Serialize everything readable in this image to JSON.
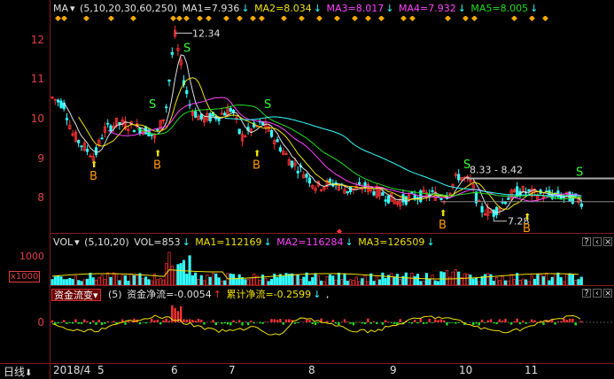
{
  "main": {
    "indicator_label": "MA",
    "params": "(5,10,20,30,60,250)",
    "ma1": "MA1=7.936",
    "ma2": "MA2=8.034",
    "ma3": "MA3=8.017",
    "ma4": "MA4=7.932",
    "ma5": "MA5=8.005",
    "y_ticks": [
      "12",
      "11",
      "10",
      "9",
      "8"
    ],
    "high_label": "12.34",
    "low_label": "7.28",
    "range_label": "8.33 - 8.42",
    "signals_b": [
      "B",
      "B",
      "B",
      "B",
      "B"
    ],
    "signals_s": [
      "S",
      "S",
      "S",
      "S",
      "S"
    ]
  },
  "volume": {
    "indicator_label": "VOL",
    "params": "(5,10,20)",
    "vol": "VOL=853",
    "ma1": "MA1=112169",
    "ma2": "MA2=116284",
    "ma3": "MA3=126509",
    "y_tick": "1000",
    "unit": "x1000"
  },
  "flow": {
    "dropdown": "资金流变",
    "params": "(5)",
    "net": "资金净流=-0.0054",
    "cumulative": "累计净流=-0.2599",
    "tail": ",",
    "y_tick": "0"
  },
  "xaxis": {
    "period": "日线",
    "labels": [
      "2018/4",
      "5",
      "6",
      "7",
      "8",
      "9",
      "10",
      "11"
    ]
  },
  "colors": {
    "up": "#ff3333",
    "down": "#33ffff",
    "ma1": "#e0e0e0",
    "ma2": "#f2e200",
    "ma3": "#ff44ff",
    "ma4": "#22dd22",
    "ma5": "#33ffff"
  }
}
